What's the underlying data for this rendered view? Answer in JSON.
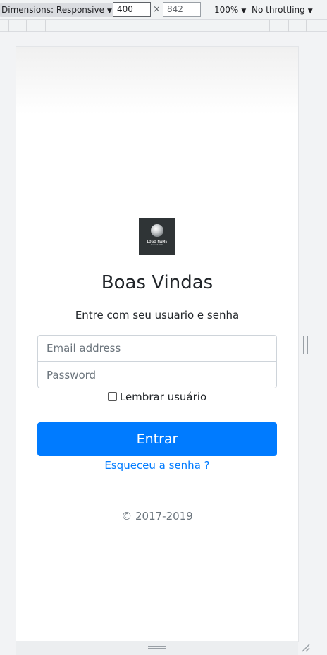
{
  "devtools": {
    "dimensions_label": "Dimensions: Responsive",
    "width_value": "400",
    "height_value": "842",
    "times": "×",
    "zoom_label": "100%",
    "throttle_label": "No throttling"
  },
  "page": {
    "logo": {
      "text": "LOGO NAME",
      "subtext": "TAGLINE HERE"
    },
    "title": "Boas Vindas",
    "subtitle": "Entre com seu usuario e senha",
    "email_placeholder": "Email address",
    "password_placeholder": "Password",
    "remember_label": "Lembrar usuário",
    "submit_label": "Entrar",
    "forgot_link": "Esqueceu a senha ?",
    "copyright": "© 2017-2019"
  },
  "colors": {
    "primary": "#007bff",
    "muted": "#6c757d"
  }
}
